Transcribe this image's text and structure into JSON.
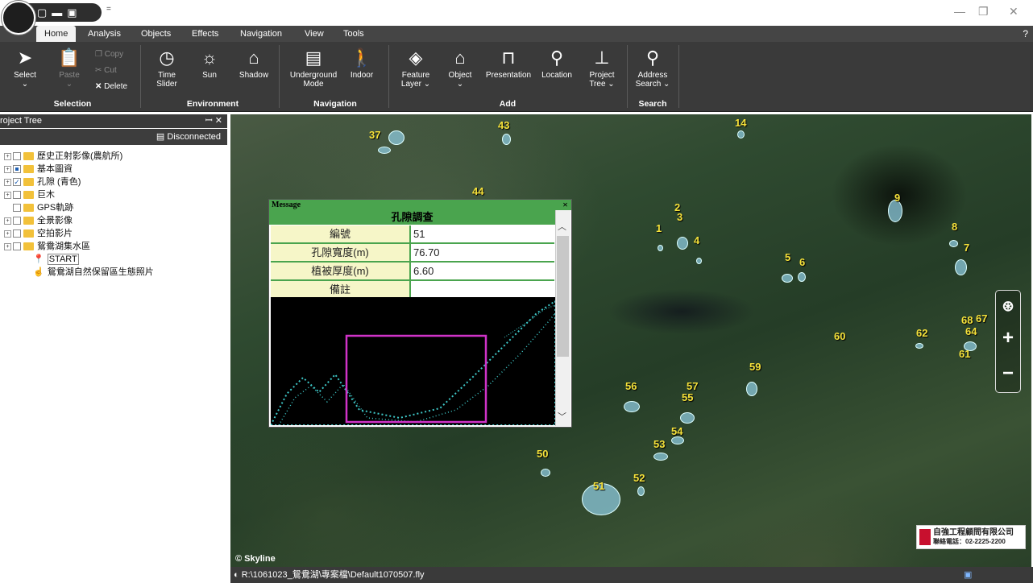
{
  "quick_access": {
    "icons": [
      "new-file-icon",
      "open-folder-icon",
      "save-icon"
    ],
    "more": "="
  },
  "tabs": [
    {
      "label": "Home",
      "active": true
    },
    {
      "label": "Analysis"
    },
    {
      "label": "Objects"
    },
    {
      "label": "Effects"
    },
    {
      "label": "Navigation"
    },
    {
      "label": "View"
    },
    {
      "label": "Tools"
    }
  ],
  "ribbon": {
    "select": {
      "label": "Select",
      "arrow": "⌄"
    },
    "paste": {
      "label": "Paste",
      "arrow": "⌄"
    },
    "copy": "Copy",
    "cut": "Cut",
    "delete": "Delete",
    "group_selection": "Selection",
    "time_slider": "Time\nSlider",
    "time_slider_1": "Time",
    "time_slider_2": "Slider",
    "sun": "Sun",
    "shadow": "Shadow",
    "group_environment": "Environment",
    "underground_1": "Underground",
    "underground_2": "Mode",
    "indoor": "Indoor",
    "group_navigation": "Navigation",
    "feature_layer_1": "Feature",
    "feature_layer_2": "Layer ⌄",
    "object": "Object",
    "object_arrow": "⌄",
    "presentation": "Presentation",
    "location": "Location",
    "project_tree_1": "Project",
    "project_tree_2": "Tree ⌄",
    "group_add": "Add",
    "address_1": "Address",
    "address_2": "Search ⌄",
    "group_search": "Search"
  },
  "project_tree": {
    "title": "roject Tree",
    "pin": "ꟷ ✕",
    "status": "Disconnected",
    "items": [
      {
        "label": "歷史正射影像(農航所)"
      },
      {
        "label": "基本圖資"
      },
      {
        "label": "孔隙 (青色)"
      },
      {
        "label": "巨木"
      },
      {
        "label": "GPS軌跡"
      },
      {
        "label": "全景影像"
      },
      {
        "label": "空拍影片"
      },
      {
        "label": "鴛鴦湖集水區"
      },
      {
        "label": "START"
      },
      {
        "label": "鴛鴦湖自然保留區生態照片"
      }
    ]
  },
  "message": {
    "header": "Message",
    "close": "×",
    "title": "孔隙調查",
    "rows": [
      {
        "key": "編號",
        "value": "51"
      },
      {
        "key": "孔隙寬度(m)",
        "value": "76.70"
      },
      {
        "key": "植被厚度(m)",
        "value": "6.60"
      },
      {
        "key": "備註",
        "value": ""
      }
    ]
  },
  "map": {
    "labels": [
      "37",
      "43",
      "14",
      "44",
      "2",
      "3",
      "1",
      "4",
      "9",
      "8",
      "7",
      "5",
      "6",
      "60",
      "62",
      "68",
      "67",
      "64",
      "61",
      "59",
      "56",
      "57",
      "55",
      "54",
      "53",
      "50",
      "52",
      "51"
    ],
    "copyright": "© Skyline",
    "company_name": "自強工程顧問有限公司",
    "company_phone": "聯絡電話：02-2225-2200"
  },
  "statusbar": {
    "path": "R:\\1061023_鴛鴦湖\\專案檔\\Default1070507.fly"
  }
}
